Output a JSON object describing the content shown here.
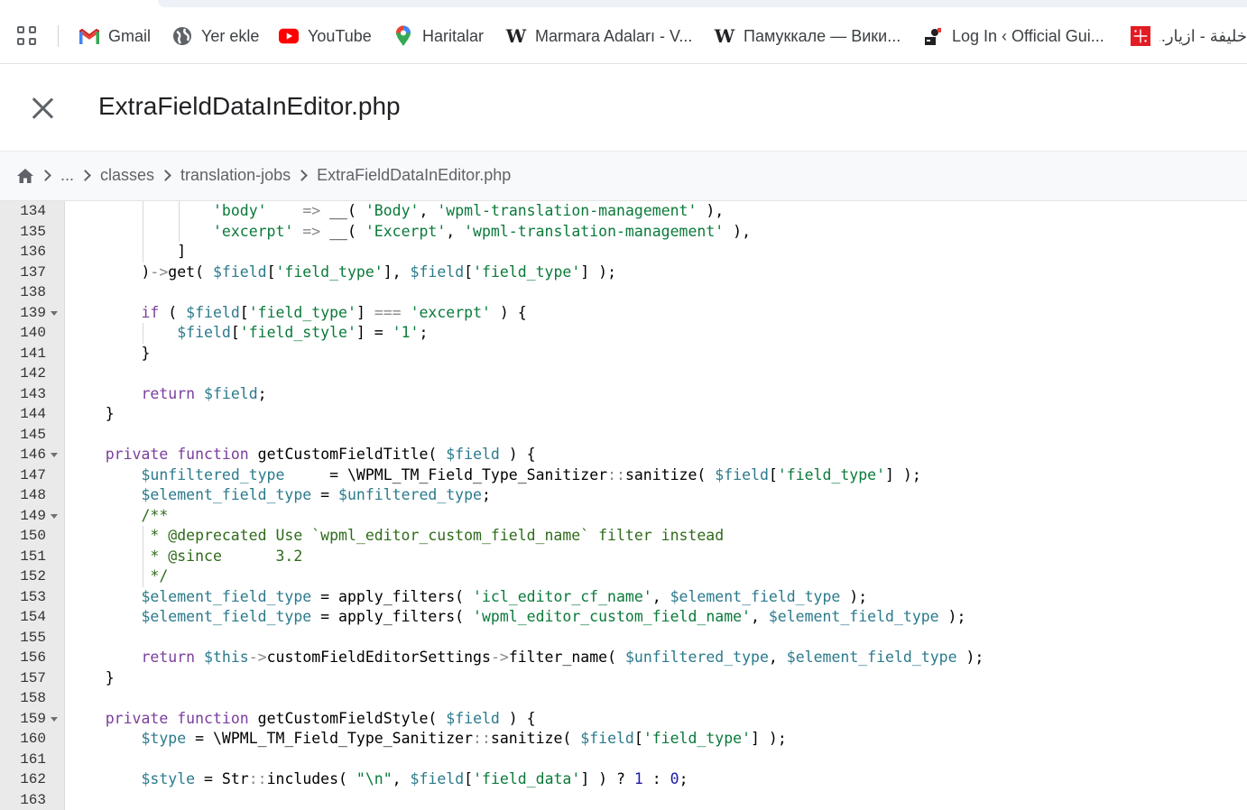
{
  "bookmarks": [
    {
      "label": "Gmail",
      "icon": "gmail-icon"
    },
    {
      "label": "Yer ekle",
      "icon": "globe-icon"
    },
    {
      "label": "YouTube",
      "icon": "youtube-icon"
    },
    {
      "label": "Haritalar",
      "icon": "maps-pin-icon"
    },
    {
      "label": "Marmara Adaları - V...",
      "icon": "wikipedia-icon"
    },
    {
      "label": "Памуккале — Вики...",
      "icon": "wikipedia-icon"
    },
    {
      "label": "Log In ‹ Official Gui...",
      "icon": "site-icon"
    },
    {
      "label": "خليفة - ازيار...",
      "icon": "site-icon-red"
    }
  ],
  "header": {
    "title": "ExtraFieldDataInEditor.php"
  },
  "breadcrumb": {
    "ellipsis": "...",
    "items": [
      "classes",
      "translation-jobs",
      "ExtraFieldDataInEditor.php"
    ]
  },
  "colors": {
    "keyword": "#7a3e9d",
    "variable": "#2b7a8c",
    "string": "#0a7a3a",
    "comment": "#2e6b1a"
  },
  "code": {
    "lines": [
      {
        "n": "134",
        "text": "            'body'    => __( 'Body', 'wpml-translation-management' ),"
      },
      {
        "n": "135",
        "text": "            'excerpt' => __( 'Excerpt', 'wpml-translation-management' ),"
      },
      {
        "n": "136",
        "text": "        ]"
      },
      {
        "n": "137",
        "text": "    )->get( $field['field_type'], $field['field_type'] );"
      },
      {
        "n": "138",
        "text": ""
      },
      {
        "n": "139",
        "text": "    if ( $field['field_type'] === 'excerpt' ) {",
        "fold": true
      },
      {
        "n": "140",
        "text": "        $field['field_style'] = '1';"
      },
      {
        "n": "141",
        "text": "    }"
      },
      {
        "n": "142",
        "text": ""
      },
      {
        "n": "143",
        "text": "    return $field;"
      },
      {
        "n": "144",
        "text": "}"
      },
      {
        "n": "145",
        "text": ""
      },
      {
        "n": "146",
        "text": "private function getCustomFieldTitle( $field ) {",
        "fold": true
      },
      {
        "n": "147",
        "text": "    $unfiltered_type     = \\WPML_TM_Field_Type_Sanitizer::sanitize( $field['field_type'] );"
      },
      {
        "n": "148",
        "text": "    $element_field_type = $unfiltered_type;"
      },
      {
        "n": "149",
        "text": "    /**",
        "fold": true
      },
      {
        "n": "150",
        "text": "     * @deprecated Use `wpml_editor_custom_field_name` filter instead"
      },
      {
        "n": "151",
        "text": "     * @since      3.2"
      },
      {
        "n": "152",
        "text": "     */"
      },
      {
        "n": "153",
        "text": "    $element_field_type = apply_filters( 'icl_editor_cf_name', $element_field_type );"
      },
      {
        "n": "154",
        "text": "    $element_field_type = apply_filters( 'wpml_editor_custom_field_name', $element_field_type );"
      },
      {
        "n": "155",
        "text": ""
      },
      {
        "n": "156",
        "text": "    return $this->customFieldEditorSettings->filter_name( $unfiltered_type, $element_field_type );"
      },
      {
        "n": "157",
        "text": "}"
      },
      {
        "n": "158",
        "text": ""
      },
      {
        "n": "159",
        "text": "private function getCustomFieldStyle( $field ) {",
        "fold": true
      },
      {
        "n": "160",
        "text": "    $type = \\WPML_TM_Field_Type_Sanitizer::sanitize( $field['field_type'] );"
      },
      {
        "n": "161",
        "text": ""
      },
      {
        "n": "162",
        "text": "    $style = Str::includes( \"\\n\", $field['field_data'] ) ? 1 : 0;"
      },
      {
        "n": "163",
        "text": ""
      }
    ]
  }
}
